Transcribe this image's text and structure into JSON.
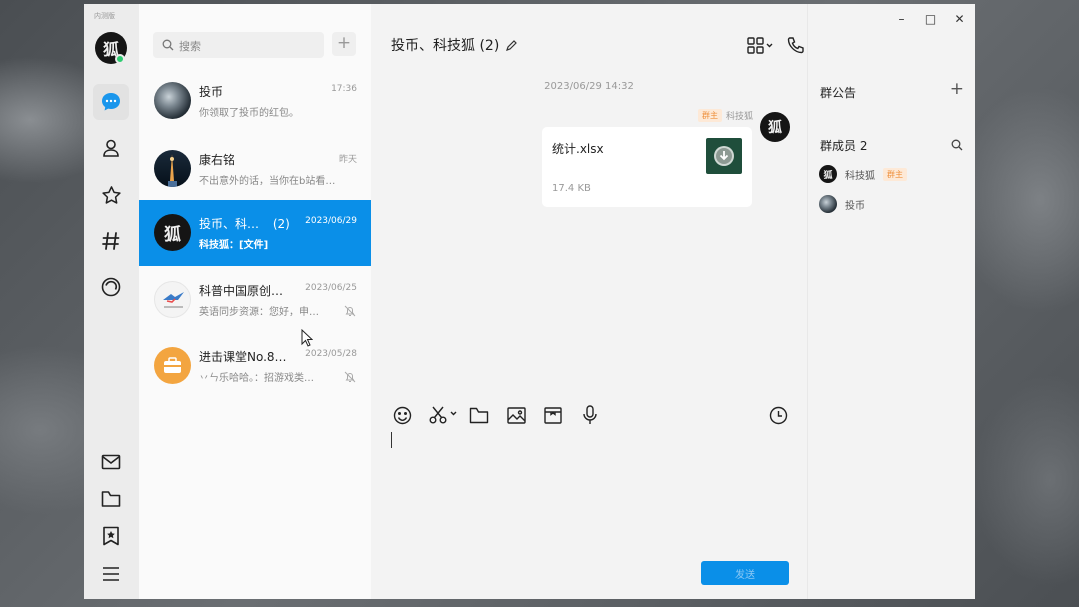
{
  "app": {
    "badge": "内测版"
  },
  "sidebar": {
    "nav_icons": [
      "chat-icon",
      "contacts-icon",
      "favorites-icon",
      "channel-icon",
      "moments-icon"
    ],
    "bottom_icons": [
      "mail-icon",
      "folder-icon",
      "bookmark-icon",
      "menu-icon"
    ],
    "accent": "#0a8fe8"
  },
  "chat_list": {
    "search_placeholder": "搜索",
    "add_label": "+",
    "items": [
      {
        "name": "投币",
        "time": "17:36",
        "preview": "你领取了投币的红包。",
        "muted": false,
        "selected": false
      },
      {
        "name": "康右铭",
        "time": "昨天",
        "preview": "不出意外的话，当你在b站看…",
        "muted": false,
        "selected": false
      },
      {
        "name": "投币、科…",
        "count": "(2)",
        "time": "2023/06/29",
        "preview": "科技狐：[文件]",
        "muted": false,
        "selected": true
      },
      {
        "name": "科普中国原创…",
        "time": "2023/06/25",
        "preview": "英语同步资源：您好，申…",
        "muted": true,
        "selected": false
      },
      {
        "name": "进击课堂No.8…",
        "time": "2023/05/28",
        "preview": "丷ㄣ乐哈哈。：招游戏类…",
        "muted": true,
        "selected": false
      }
    ]
  },
  "conversation": {
    "title": "投币、科技狐 (2)",
    "header_icons": [
      "apps-icon",
      "phone-icon",
      "video-icon",
      "screen-share-icon",
      "add-member-icon",
      "more-icon"
    ],
    "timestamp": "2023/06/29 14:32",
    "message": {
      "sender_role": "群主",
      "sender": "科技狐",
      "avatar_text": "狐",
      "file_name": "统计.xlsx",
      "file_size": "17.4 KB"
    },
    "toolbar_icons": [
      "emoji-icon",
      "scissors-icon",
      "folder-icon",
      "image-icon",
      "gift-icon",
      "microphone-icon",
      "history-icon"
    ],
    "send_label": "发送"
  },
  "group_panel": {
    "announcement_label": "群公告",
    "announcement_add": "+",
    "members_label": "群成员 2",
    "members": [
      {
        "name": "科技狐",
        "tag": "群主"
      },
      {
        "name": "投币",
        "tag": ""
      }
    ]
  },
  "window_controls": {
    "minimize": "–",
    "maximize": "□",
    "close": "✕"
  }
}
